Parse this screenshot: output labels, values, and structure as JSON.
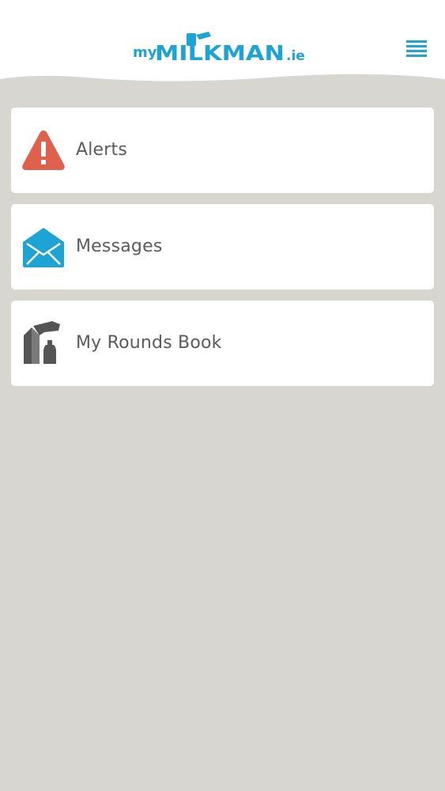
{
  "header": {
    "logo": {
      "prefix": "my",
      "main": "MILKMAN",
      "suffix": ".ie"
    },
    "menu_icon": "hamburger-menu-icon"
  },
  "menu": {
    "items": [
      {
        "label": "Alerts",
        "icon": "warning-triangle-icon",
        "icon_color": "#e0604e"
      },
      {
        "label": "Messages",
        "icon": "envelope-icon",
        "icon_color": "#1ea3d5"
      },
      {
        "label": "My Rounds Book",
        "icon": "milk-delivery-icon",
        "icon_color": "#555555"
      }
    ]
  },
  "colors": {
    "brand_blue": "#1ea3d5",
    "background": "#d7d6d1",
    "card": "#ffffff",
    "text": "#5b5b5b",
    "alert_red": "#e0604e"
  }
}
